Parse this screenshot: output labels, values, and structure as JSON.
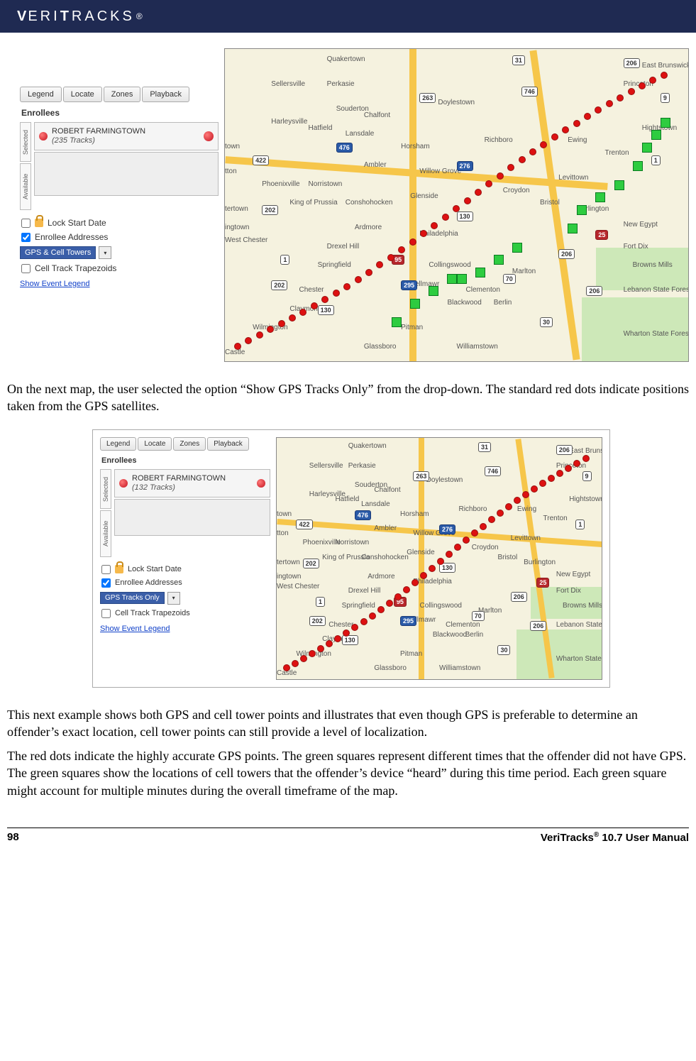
{
  "brand": {
    "name": "VERITRACKS",
    "reg": "®"
  },
  "tabs": {
    "legend": "Legend",
    "locate": "Locate",
    "zones": "Zones",
    "playback": "Playback"
  },
  "panel": {
    "enrollees_heading": "Enrollees",
    "selected_label_side": "Selected",
    "available_label_side": "Available",
    "lock_start": "Lock Start Date",
    "enrollee_addresses": "Enrollee Addresses",
    "cell_trapezoids": "Cell Track Trapezoids",
    "show_legend": "Show Event Legend"
  },
  "fig1": {
    "enrollee": {
      "name": "ROBERT FARMINGTOWN",
      "tracks": "(235 Tracks)"
    },
    "dropdown": "GPS & Cell Towers"
  },
  "fig2": {
    "enrollee": {
      "name": "ROBERT FARMINGTOWN",
      "tracks": "(132 Tracks)"
    },
    "dropdown": "GPS Tracks Only"
  },
  "map_labels": {
    "quakertown": "Quakertown",
    "sellersville": "Sellersville",
    "perkasie": "Perkasie",
    "doylestown": "Doylestown",
    "hatfield": "Hatfield",
    "lansdale": "Lansdale",
    "souderton": "Souderton",
    "harleysville": "Harleysville",
    "chalfont": "Chalfont",
    "richboro": "Richboro",
    "horsham": "Horsham",
    "ambler": "Ambler",
    "willowgrove": "Willow Grove",
    "glenside": "Glenside",
    "croydon": "Croydon",
    "bristol": "Bristol",
    "king": "King of Prussia",
    "conshohocken": "Conshohocken",
    "norristown": "Norristown",
    "phoenixville": "Phoenixville",
    "ardmore": "Ardmore",
    "drexel": "Drexel Hill",
    "philadelphia": "Philadelphia",
    "springfield": "Springfield",
    "chester": "Chester",
    "collingswood": "Collingswood",
    "bellmawr": "Bellmawr",
    "claymont": "Claymont",
    "wilmington": "Wilmington",
    "blackwood": "Blackwood",
    "berlin": "Berlin",
    "marlton": "Marlton",
    "pitman": "Pitman",
    "glassboro": "Glassboro",
    "williamstown": "Williamstown",
    "clementon": "Clementon",
    "ewing": "Ewing",
    "trenton": "Trenton",
    "levittown": "Levittown",
    "burlington": "Burlington",
    "newegypt": "New Egypt",
    "fortdix": "Fort Dix",
    "browns": "Browns Mills",
    "princeton": "Princeton",
    "hightstown": "Hightstown",
    "eastbrunswick": "East Brunswick",
    "lebanon": "Lebanon State Forest",
    "wharton": "Wharton State Forest",
    "westchester": "West Chester",
    "castle": "Castle",
    "town": "town",
    "tton": "tton",
    "ingtown": "ingtown",
    "tertown": "tertown"
  },
  "shields": {
    "s31": "31",
    "s263": "263",
    "s206": "206",
    "s130": "130",
    "s422": "422",
    "s202": "202",
    "s476": "476",
    "s276": "276",
    "s1": "1",
    "s295": "295",
    "s95": "95",
    "s30": "30",
    "s70": "70",
    "s9": "9",
    "s25": "25",
    "s746": "746"
  },
  "body": {
    "p1": "On the next map, the user selected the option “Show GPS Tracks Only” from the drop-down.  The standard red dots indicate positions taken from the GPS satellites.",
    "p2": "This next example shows both GPS and cell tower points and illustrates that even though GPS is preferable to determine an offender’s exact location, cell tower points can still provide a level of localization.",
    "p3": "The red dots indicate the highly accurate GPS points.  The green squares represent different times that the offender did not have GPS.  The green squares show the locations of cell towers that the offender’s device “heard” during this time period.  Each green square might account for multiple minutes during the overall timeframe of the map."
  },
  "footer": {
    "page": "98",
    "title_a": "VeriTracks",
    "reg": "®",
    "title_b": " 10.7 User Manual"
  }
}
